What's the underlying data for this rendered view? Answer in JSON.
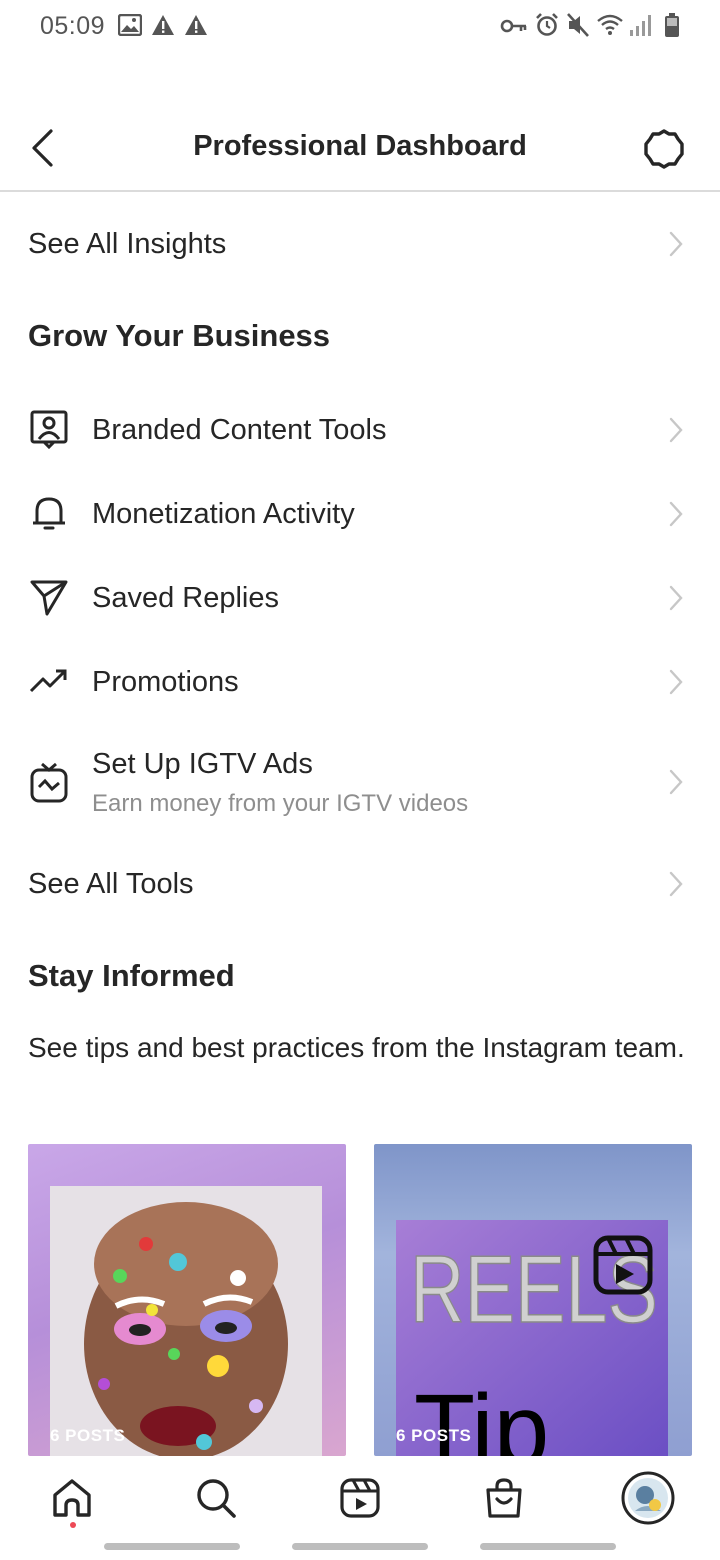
{
  "status_bar": {
    "time": "05:09",
    "left_icons": [
      "image-icon",
      "warning-icon",
      "warning-icon"
    ],
    "right_icons": [
      "vpn-key-icon",
      "alarm-icon",
      "mute-icon",
      "wifi-icon",
      "signal-icon",
      "battery-icon"
    ]
  },
  "header": {
    "title": "Professional Dashboard",
    "back_icon": "chevron-left-icon",
    "settings_icon": "settings-gear-icon"
  },
  "insights": {
    "label": "See All Insights"
  },
  "grow_section": {
    "title": "Grow Your Business",
    "items": [
      {
        "label": "Branded Content Tools",
        "icon": "branded-content-icon"
      },
      {
        "label": "Monetization Activity",
        "icon": "bell-icon"
      },
      {
        "label": "Saved Replies",
        "icon": "send-icon"
      },
      {
        "label": "Promotions",
        "icon": "trend-up-icon"
      },
      {
        "label": "Set Up IGTV Ads",
        "sublabel": "Earn money from your IGTV videos",
        "icon": "igtv-icon"
      }
    ],
    "see_all_tools": "See All Tools"
  },
  "stay_informed": {
    "title": "Stay Informed",
    "description": "See tips and best practices from the Instagram team.",
    "cards": [
      {
        "badge": "6 POSTS"
      },
      {
        "badge": "6 POSTS",
        "image_text_1": "REELS",
        "image_text_2": "Tip"
      }
    ]
  },
  "bottom_nav": {
    "items": [
      "home-icon",
      "search-icon",
      "reels-icon",
      "shop-icon",
      "profile-avatar"
    ]
  },
  "colors": {
    "text_primary": "#262626",
    "text_secondary": "#8e8e8e",
    "divider": "#dbdbdb",
    "chevron": "#c7c7c7",
    "notification_dot": "#ed4956"
  }
}
